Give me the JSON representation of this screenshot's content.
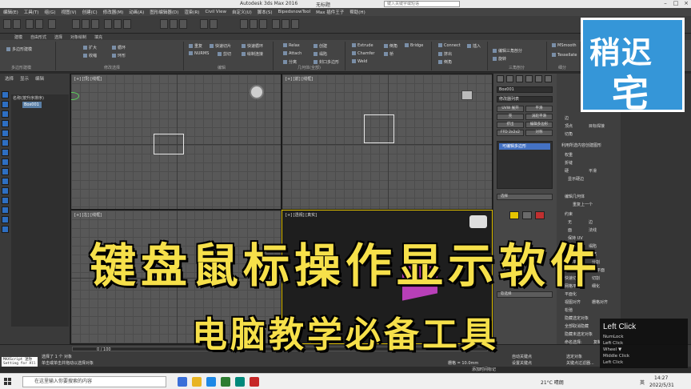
{
  "titlebar": {
    "title": "Autodesk 3ds Max 2016",
    "doc": "无标题",
    "search_placeholder": "键入关键字或短语"
  },
  "menubar": [
    "编辑(E)",
    "工具(T)",
    "组(G)",
    "视图(V)",
    "创建(C)",
    "修改器(M)",
    "动画(A)",
    "图形编辑器(D)",
    "渲染(R)",
    "Civil View",
    "自定义(U)",
    "脚本(S)",
    "BipedsnowTool",
    "Max 插件王子",
    "帮助(H)"
  ],
  "ribbon": {
    "tabs": [
      "建模",
      "自由形式",
      "选择",
      "对象绘制",
      "填充"
    ],
    "groups": [
      {
        "label": "多边形建模",
        "items": [
          "多边形建模"
        ]
      },
      {
        "label": "修改选择",
        "items": [
          "扩大",
          "收缩",
          "循环",
          "环形"
        ]
      },
      {
        "label": "编辑",
        "items": [
          "重复",
          "快速切片",
          "快速循环",
          "NURMS",
          "剪切",
          "绘制连接"
        ]
      },
      {
        "label": "几何体(全部)",
        "items": [
          "Relax",
          "创建",
          "Attach",
          "塌陷",
          "分离",
          "封口多边形"
        ]
      },
      {
        "label": "",
        "items": [
          "Extrude",
          "倒角",
          "Chamfer",
          "Weld",
          "桥",
          "Bridge"
        ]
      },
      {
        "label": "",
        "items": [
          "Connect",
          "插入",
          "挤出",
          "倒角"
        ]
      },
      {
        "label": "三角剖分",
        "items": [
          "编辑三角剖分",
          "旋转"
        ]
      },
      {
        "label": "细分",
        "items": [
          "MSmooth",
          "Tessellate"
        ]
      }
    ]
  },
  "scene": {
    "tabs": [
      "选择",
      "显示",
      "编辑"
    ],
    "header": "名称(按升序排序)",
    "items": [
      "Box001"
    ]
  },
  "viewports": {
    "top_left": "[+] [顶] [线框]",
    "top_right": "[+] [前] [线框]",
    "bottom_left": "[+] [左] [线框]",
    "bottom_right": "[+] [透视] [真实]"
  },
  "command": {
    "object_name": "Box001",
    "modifier_list": "修改器列表",
    "buttons": [
      "UVW 展开",
      "平滑",
      "壳",
      "涡轮平滑",
      "挤出",
      "编辑多边形",
      "FFD 2x2x2",
      "对称"
    ],
    "stack_item": "可编辑多边形",
    "selection": "选择",
    "soft_selection": "软选择"
  },
  "right_panel": {
    "items": [
      "边",
      "顶点",
      "目标焊接",
      "切角",
      "利用所选内容创建图形",
      "权重",
      "折缝",
      "硬",
      "平滑",
      "显示硬边",
      "编辑几何体",
      "重复上一个",
      "约束",
      "无",
      "边",
      "面",
      "法线",
      "保持 UV",
      "创建",
      "塌陷",
      "附加",
      "分离",
      "切片平面",
      "分割",
      "切片",
      "重置平面",
      "快速切片",
      "切割",
      "网格平滑",
      "细化",
      "平面化",
      "视图对齐",
      "栅格对齐",
      "松弛",
      "隐藏选定对象",
      "全部取消隐藏",
      "隐藏未选定对象",
      "命名选择:",
      "复制",
      "粘贴",
      "删除孤立顶点",
      "完全交互"
    ]
  },
  "logo": {
    "line1": "稍迟",
    "line2": "宅"
  },
  "key_overlay": {
    "main": "Left Click",
    "lines": [
      "NumLock",
      "Left Click",
      "Wheel ▼",
      "Middle Click",
      "Left Click"
    ]
  },
  "headline1": "键盘鼠标操作显示软件",
  "headline2": "电脑教学必备工具",
  "status": {
    "frame": "0 / 100",
    "selected": "选择了 1 个 对象",
    "hint": "单击或单击并拖动以选择对象",
    "grid": "栅格 = 10.0mm",
    "auto_key": "自动关键点",
    "set_key": "设置关键点",
    "selected_filter": "选定对象",
    "add_time_tag": "添加时间标记",
    "key_filter": "关键点过滤器...",
    "miniscript_1": "MAXScript 迷你",
    "miniscript_2": "Setting for All"
  },
  "taskbar": {
    "search_placeholder": "在这里输入你要搜索的内容",
    "weather": "21°C 晴朗",
    "time": "14:27",
    "date": "2022/5/31",
    "lang": "英"
  }
}
